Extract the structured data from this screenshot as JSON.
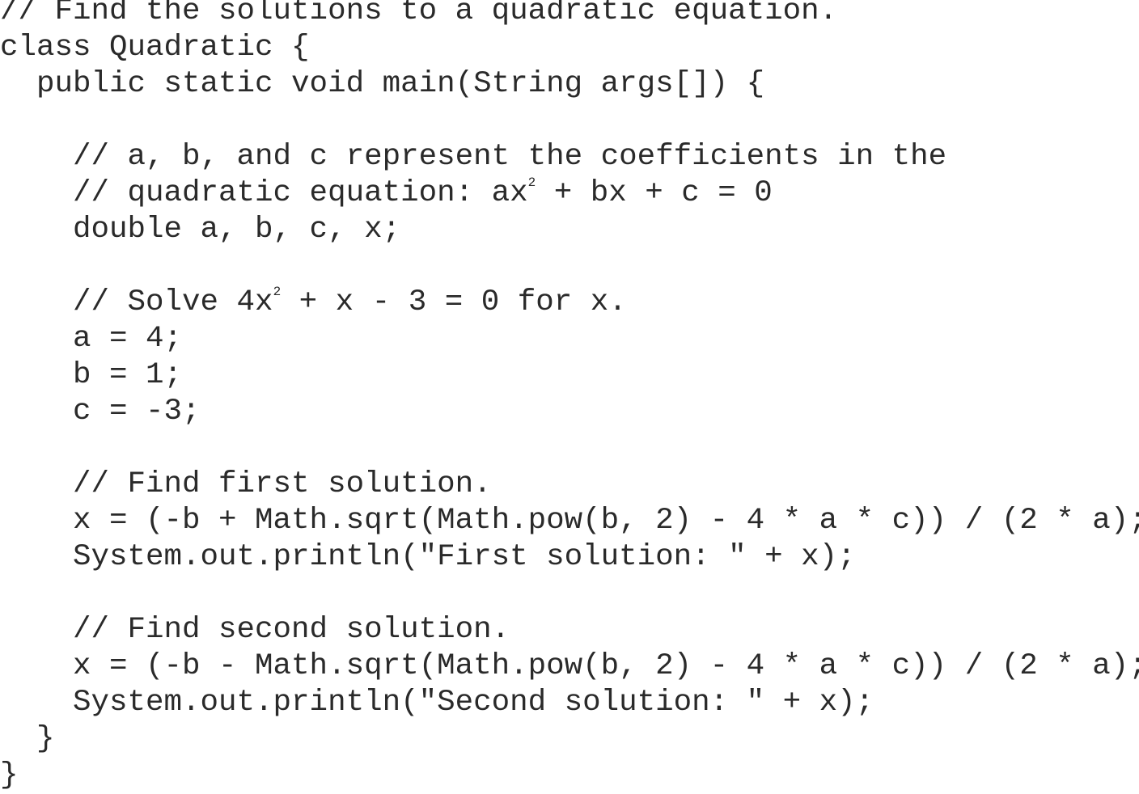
{
  "code": {
    "lines": [
      "// Find the solutions to a quadratic equation.",
      "class Quadratic {",
      "  public static void main(String args[]) {",
      "",
      "    // a, b, and c represent the coefficients in the",
      {
        "before": "    // quadratic equation: ax",
        "sup": "2",
        "after": " + bx + c = 0"
      },
      "    double a, b, c, x;",
      "",
      {
        "before": "    // Solve 4x",
        "sup": "2",
        "after": " + x - 3 = 0 for x."
      },
      "    a = 4;",
      "    b = 1;",
      "    c = -3;",
      "",
      "    // Find first solution.",
      "    x = (-b + Math.sqrt(Math.pow(b, 2) - 4 * a * c)) / (2 * a);",
      "    System.out.println(\"First solution: \" + x);",
      "",
      "    // Find second solution.",
      "    x = (-b - Math.sqrt(Math.pow(b, 2) - 4 * a * c)) / (2 * a);",
      "    System.out.println(\"Second solution: \" + x);",
      "  }",
      "}"
    ]
  }
}
